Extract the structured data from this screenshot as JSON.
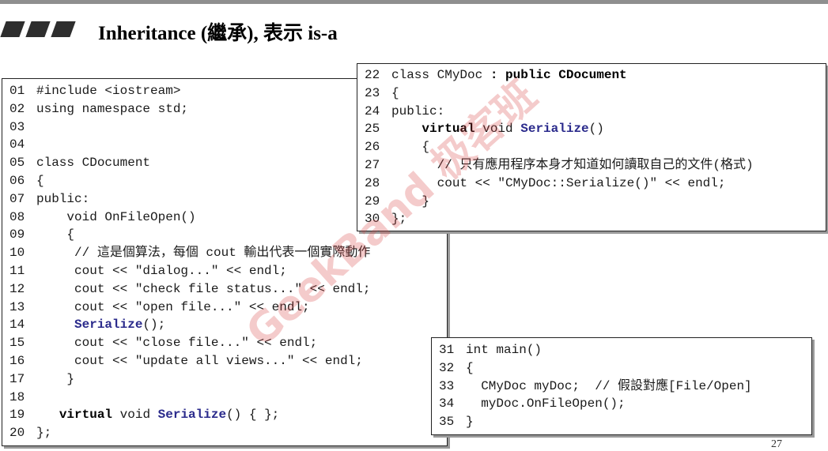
{
  "title": "Inheritance (繼承), 表示 is-a",
  "watermark": "GeekBand 极客班",
  "page_number": "27",
  "box1": {
    "lines": [
      {
        "num": "01",
        "parts": [
          {
            "t": "#include <iostream>",
            "s": ""
          }
        ]
      },
      {
        "num": "02",
        "parts": [
          {
            "t": "using namespace std;",
            "s": ""
          }
        ]
      },
      {
        "num": "03",
        "parts": [
          {
            "t": "",
            "s": ""
          }
        ]
      },
      {
        "num": "04",
        "parts": [
          {
            "t": "",
            "s": ""
          }
        ]
      },
      {
        "num": "05",
        "parts": [
          {
            "t": "class CDocument",
            "s": ""
          }
        ]
      },
      {
        "num": "06",
        "parts": [
          {
            "t": "{",
            "s": ""
          }
        ]
      },
      {
        "num": "07",
        "parts": [
          {
            "t": "public:",
            "s": ""
          }
        ]
      },
      {
        "num": "08",
        "parts": [
          {
            "t": "    void OnFileOpen()",
            "s": ""
          }
        ]
      },
      {
        "num": "09",
        "parts": [
          {
            "t": "    {",
            "s": ""
          }
        ]
      },
      {
        "num": "10",
        "parts": [
          {
            "t": "     // 這是個算法，每個 cout 輸出代表一個實際動作",
            "s": ""
          }
        ]
      },
      {
        "num": "11",
        "parts": [
          {
            "t": "     cout << \"dialog...\" << endl;",
            "s": ""
          }
        ]
      },
      {
        "num": "12",
        "parts": [
          {
            "t": "     cout << \"check file status...\" << endl;",
            "s": ""
          }
        ]
      },
      {
        "num": "13",
        "parts": [
          {
            "t": "     cout << \"open file...\" << endl;",
            "s": ""
          }
        ]
      },
      {
        "num": "14",
        "parts": [
          {
            "t": "     ",
            "s": ""
          },
          {
            "t": "Serialize",
            "s": "fn"
          },
          {
            "t": "();",
            "s": ""
          }
        ]
      },
      {
        "num": "15",
        "parts": [
          {
            "t": "     cout << \"close file...\" << endl;",
            "s": ""
          }
        ]
      },
      {
        "num": "16",
        "parts": [
          {
            "t": "     cout << \"update all views...\" << endl;",
            "s": ""
          }
        ]
      },
      {
        "num": "17",
        "parts": [
          {
            "t": "    }",
            "s": ""
          }
        ]
      },
      {
        "num": "18",
        "parts": [
          {
            "t": "",
            "s": ""
          }
        ]
      },
      {
        "num": "19",
        "parts": [
          {
            "t": "   ",
            "s": ""
          },
          {
            "t": "virtual",
            "s": "kw"
          },
          {
            "t": " void ",
            "s": ""
          },
          {
            "t": "Serialize",
            "s": "fn"
          },
          {
            "t": "() { };",
            "s": ""
          }
        ]
      },
      {
        "num": "20",
        "parts": [
          {
            "t": "};",
            "s": ""
          }
        ]
      }
    ]
  },
  "box2": {
    "lines": [
      {
        "num": "22",
        "parts": [
          {
            "t": "class CMyDoc ",
            "s": ""
          },
          {
            "t": ": public CDocument",
            "s": "kw"
          }
        ]
      },
      {
        "num": "23",
        "parts": [
          {
            "t": "{",
            "s": ""
          }
        ]
      },
      {
        "num": "24",
        "parts": [
          {
            "t": "public:",
            "s": ""
          }
        ]
      },
      {
        "num": "25",
        "parts": [
          {
            "t": "    ",
            "s": ""
          },
          {
            "t": "virtual",
            "s": "kw"
          },
          {
            "t": " void ",
            "s": ""
          },
          {
            "t": "Serialize",
            "s": "fn"
          },
          {
            "t": "()",
            "s": ""
          }
        ]
      },
      {
        "num": "26",
        "parts": [
          {
            "t": "    {",
            "s": ""
          }
        ]
      },
      {
        "num": "27",
        "parts": [
          {
            "t": "      // 只有應用程序本身才知道如何讀取自己的文件(格式)",
            "s": ""
          }
        ]
      },
      {
        "num": "28",
        "parts": [
          {
            "t": "      cout << \"CMyDoc::Serialize()\" << endl;",
            "s": ""
          }
        ]
      },
      {
        "num": "29",
        "parts": [
          {
            "t": "    }",
            "s": ""
          }
        ]
      },
      {
        "num": "30",
        "parts": [
          {
            "t": "};",
            "s": ""
          }
        ]
      }
    ]
  },
  "box3": {
    "lines": [
      {
        "num": "31",
        "parts": [
          {
            "t": "int main()",
            "s": ""
          }
        ]
      },
      {
        "num": "32",
        "parts": [
          {
            "t": "{",
            "s": ""
          }
        ]
      },
      {
        "num": "33",
        "parts": [
          {
            "t": "  CMyDoc myDoc;  // 假設對應[File/Open]",
            "s": ""
          }
        ]
      },
      {
        "num": "34",
        "parts": [
          {
            "t": "  myDoc.OnFileOpen();",
            "s": ""
          }
        ]
      },
      {
        "num": "35",
        "parts": [
          {
            "t": "}",
            "s": ""
          }
        ]
      }
    ]
  }
}
